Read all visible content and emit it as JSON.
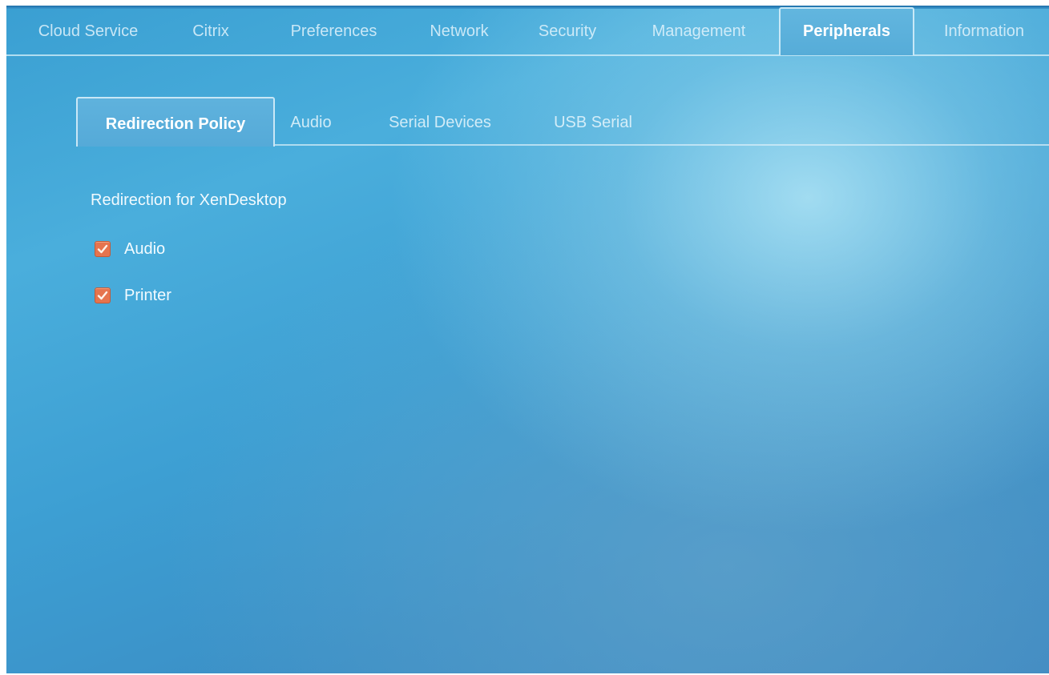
{
  "top_nav": {
    "tabs": [
      {
        "label": "Cloud Service",
        "active": false
      },
      {
        "label": "Citrix",
        "active": false
      },
      {
        "label": "Preferences",
        "active": false
      },
      {
        "label": "Network",
        "active": false
      },
      {
        "label": "Security",
        "active": false
      },
      {
        "label": "Management",
        "active": false
      },
      {
        "label": "Peripherals",
        "active": true
      },
      {
        "label": "Information",
        "active": false
      }
    ]
  },
  "sub_nav": {
    "tabs": [
      {
        "label": "Redirection Policy",
        "active": true
      },
      {
        "label": "Audio",
        "active": false
      },
      {
        "label": "Serial Devices",
        "active": false
      },
      {
        "label": "USB Serial",
        "active": false
      }
    ]
  },
  "content": {
    "section_title": "Redirection for XenDesktop",
    "options": [
      {
        "label": "Audio",
        "checked": true
      },
      {
        "label": "Printer",
        "checked": true
      }
    ]
  },
  "colors": {
    "checkbox": "#e6744e",
    "background": "#3d9fd3"
  }
}
